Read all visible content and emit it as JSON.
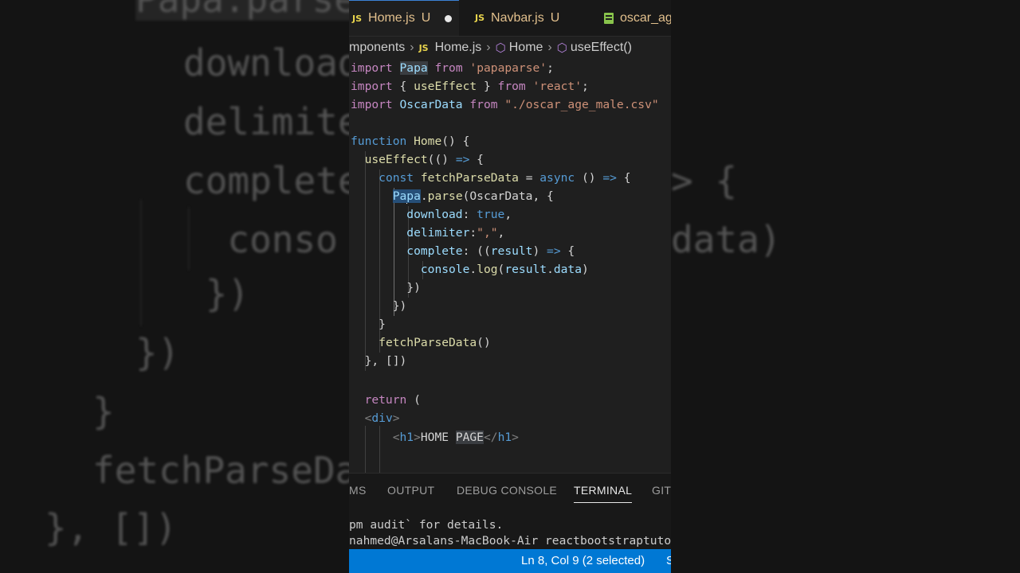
{
  "background": {
    "lines": [
      "Papa.parse",
      "download",
      "delimite",
      "complete",
      "  conso",
      " })",
      "})",
      "}",
      "fetchParseDa",
      "}, [])"
    ],
    "right_lines": [
      "> {",
      "data)"
    ]
  },
  "tabs": [
    {
      "icon": "JS",
      "label": "Home.js",
      "status": "U"
    },
    {
      "icon": "JS",
      "label": "Navbar.js",
      "status": "U"
    },
    {
      "icon": "csv",
      "label": "oscar_ag"
    }
  ],
  "breadcrumb": {
    "folder": "mponents",
    "file_icon": "JS",
    "file": "Home.js",
    "symbol": "Home",
    "method": "useEffect()"
  },
  "code": {
    "l1": {
      "kw": "import",
      "name": "Papa",
      "from": "from",
      "src": "'papaparse'",
      "end": ";"
    },
    "l2": {
      "kw": "import",
      "open": "{ ",
      "name": "useEffect",
      "close": " }",
      "from": "from",
      "src": "'react'",
      "end": ";"
    },
    "l3": {
      "kw": "import",
      "name": "OscarData",
      "from": "from",
      "src": "\"./oscar_age_male.csv\""
    },
    "l5": {
      "kw": "function",
      "name": "Home",
      "rest": "() {"
    },
    "l6": {
      "fn": "useEffect",
      "rest1": "(() ",
      "arrow": "=>",
      "rest2": " {"
    },
    "l7": {
      "kw": "const",
      "name": "fetchParseData",
      "eq": " = ",
      "async": "async",
      "rest1": " () ",
      "arrow": "=>",
      "rest2": " {"
    },
    "l8": {
      "sel1": "Pa",
      "sel2": "pa",
      "dot": ".",
      "fn": "parse",
      "rest": "(OscarData, {"
    },
    "l9": {
      "key": "download",
      "colon": ": ",
      "val": "true",
      "end": ","
    },
    "l10": {
      "key": "delimiter",
      "colon": ":",
      "val": "\",\"",
      "end": ","
    },
    "l11": {
      "key": "complete",
      "rest1": ": ((",
      "param": "result",
      "rest2": ") ",
      "arrow": "=>",
      "rest3": " {"
    },
    "l12": {
      "obj": "console",
      "dot": ".",
      "fn": "log",
      "rest1": "(",
      "a": "result",
      "dot2": ".",
      "b": "data",
      "rest2": ")"
    },
    "l13": "})",
    "l14": "})",
    "l15": "}",
    "l16": {
      "fn": "fetchParseData",
      "rest": "()"
    },
    "l17": "}, [])",
    "l19": {
      "kw": "return",
      "rest": " ("
    },
    "l20": {
      "open": "<",
      "tag": "div",
      "close": ">"
    },
    "l21": {
      "open": "<",
      "tag": "h1",
      "close": ">",
      "text1": "HOME ",
      "text2": "PAGE",
      "open2": "</",
      "tag2": "h1",
      "close2": ">"
    }
  },
  "panel": {
    "tabs": [
      "MS",
      "OUTPUT",
      "DEBUG CONSOLE",
      "TERMINAL",
      "GIT"
    ],
    "active_tab": "TERMINAL",
    "terminal_lines": [
      "pm audit` for details.",
      "nahmed@Arsalans-MacBook-Air reactbootstraptuto"
    ]
  },
  "status": {
    "position": "Ln 8, Col 9 (2 selected)",
    "trailing": "S"
  },
  "colors": {
    "status_bar": "#0078d4",
    "tab_modified": "#e2c08d",
    "selection": "#264f78"
  }
}
